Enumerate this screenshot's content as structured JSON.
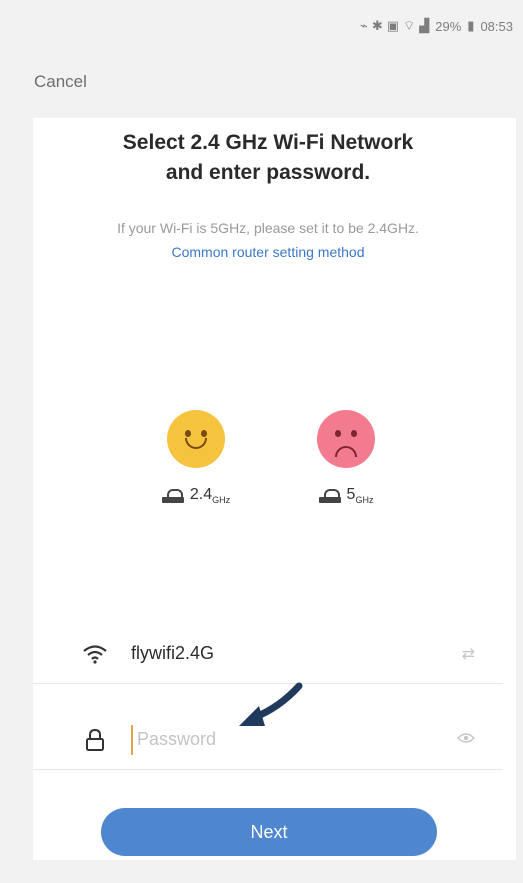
{
  "status_bar": {
    "battery": "29%",
    "time": "08:53"
  },
  "nav": {
    "cancel_label": "Cancel"
  },
  "header": {
    "title_line1": "Select 2.4 GHz Wi-Fi Network",
    "title_line2": "and enter password."
  },
  "hint": {
    "text": "If your Wi-Fi is 5GHz, please set it to be 2.4GHz.",
    "link": "Common router setting method"
  },
  "bands": [
    {
      "label": "2.4",
      "unit": "GHz",
      "face": "happy"
    },
    {
      "label": "5",
      "unit": "GHz",
      "face": "sad"
    }
  ],
  "wifi": {
    "ssid": "flywifi2.4G",
    "icon": "wifi-icon",
    "trail_icon": "switch-network-icon"
  },
  "password": {
    "placeholder": "Password",
    "value": "",
    "icon": "lock-icon",
    "trail_icon": "eye-icon"
  },
  "actions": {
    "next_label": "Next"
  },
  "colors": {
    "accent": "#4e86cf",
    "happy": "#f5c33d",
    "sad": "#f27b8f"
  }
}
